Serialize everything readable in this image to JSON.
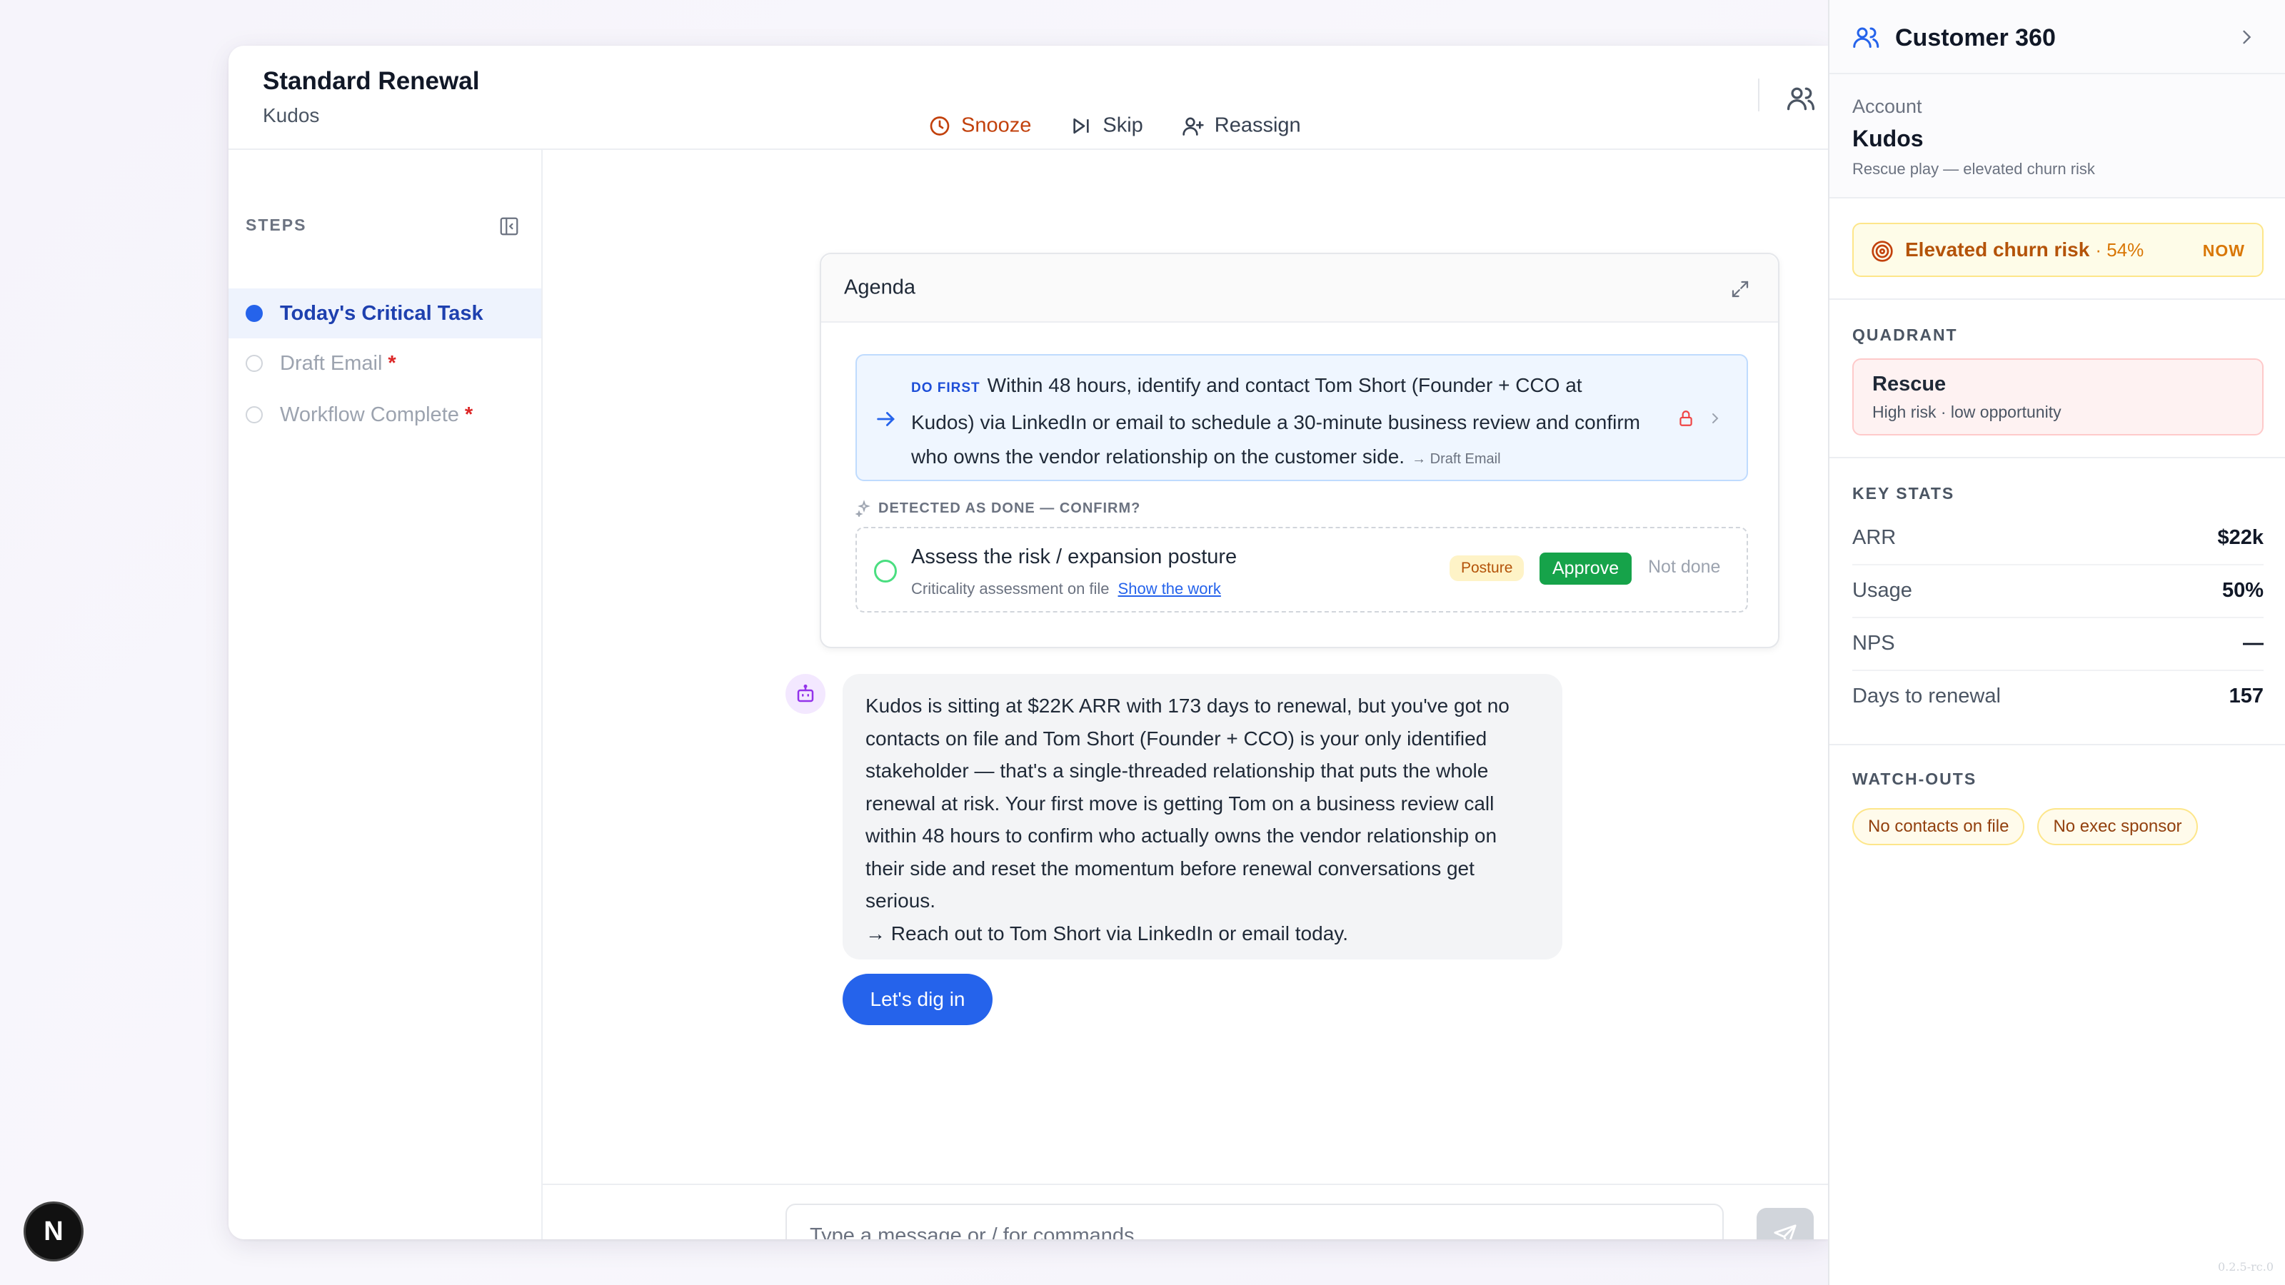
{
  "header": {
    "title": "Standard Renewal",
    "account": "Kudos",
    "actions": {
      "snooze": "Snooze",
      "skip": "Skip",
      "reassign": "Reassign"
    }
  },
  "steps": {
    "label": "STEPS",
    "items": [
      {
        "label": "Today's Critical Task",
        "state": "active",
        "required": ""
      },
      {
        "label": "Draft Email",
        "state": "pending",
        "required": "*"
      },
      {
        "label": "Workflow Complete",
        "state": "pending",
        "required": "*"
      }
    ]
  },
  "agenda": {
    "title": "Agenda",
    "do_first": {
      "tag": "DO FIRST",
      "text": "Within 48 hours, identify and contact Tom Short (Founder + CCO at Kudos) via LinkedIn or email to schedule a 30-minute business review and confirm who owns the vendor relationship on the customer side.",
      "link": "→ Draft Email"
    },
    "detected_label": "DETECTED AS DONE — CONFIRM?",
    "confirm": {
      "title": "Assess the risk / expansion posture",
      "subtitle": "Criticality assessment on file",
      "show_work": "Show the work",
      "badge": "Posture",
      "approve": "Approve",
      "not_done": "Not done"
    }
  },
  "chat": {
    "bot_message": "Kudos is sitting at $22K ARR with 173 days to renewal, but you've got no contacts on file and Tom Short (Founder + CCO) is your only identified stakeholder — that's a single-threaded relationship that puts the whole renewal at risk. Your first move is getting Tom on a business review call within 48 hours to confirm who actually owns the vendor relationship on their side and reset the momentum before renewal conversations get serious.",
    "bot_followup": "→ Reach out to Tom Short via LinkedIn or email today.",
    "cta": "Let's dig in",
    "input_placeholder": "Type a message or / for commands..."
  },
  "customer360": {
    "title": "Customer 360",
    "account_label": "Account",
    "account_name": "Kudos",
    "account_sub": "Rescue play — elevated churn risk",
    "risk": {
      "label": "Elevated churn risk",
      "pct": "· 54%",
      "tag": "NOW"
    },
    "quadrant_label": "QUADRANT",
    "quadrant": {
      "name": "Rescue",
      "desc": "High risk · low opportunity"
    },
    "stats_label": "KEY STATS",
    "stats": [
      {
        "label": "ARR",
        "value": "$22k"
      },
      {
        "label": "Usage",
        "value": "50%"
      },
      {
        "label": "NPS",
        "value": "—"
      },
      {
        "label": "Days to renewal",
        "value": "157"
      }
    ],
    "watchouts_label": "WATCH-OUTS",
    "watchouts": [
      "No contacts on file",
      "No exec sponsor"
    ],
    "version": "0.2.5-rc.0"
  },
  "badge": {
    "letter": "N"
  },
  "colors": {
    "accent": "#2563eb",
    "snooze": "#c2410c",
    "approve": "#16a34a",
    "risk": "#b45309"
  }
}
